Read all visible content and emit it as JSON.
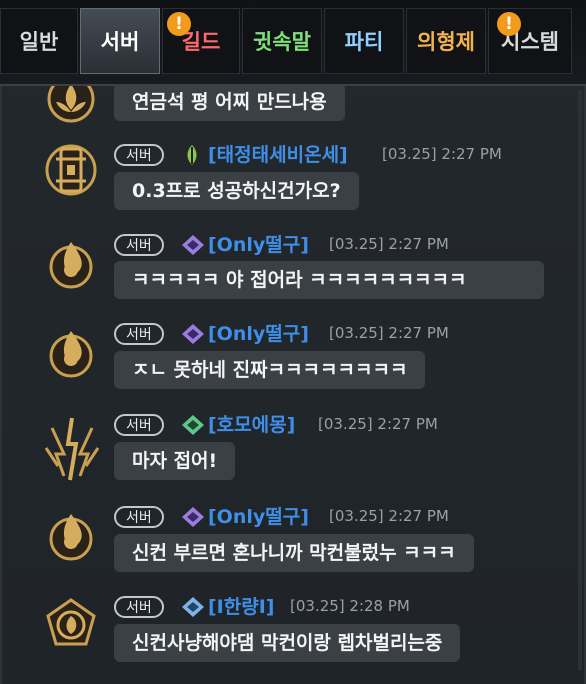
{
  "tabs": [
    {
      "label": "일반",
      "color": "#d8dadc",
      "active": false,
      "badge": false
    },
    {
      "label": "서버",
      "color": "#ffffff",
      "active": true,
      "badge": false
    },
    {
      "label": "길드",
      "color": "#ff6a6a",
      "active": false,
      "badge": true
    },
    {
      "label": "귓속말",
      "color": "#7fe07a",
      "active": false,
      "badge": false
    },
    {
      "label": "파티",
      "color": "#8fd0ff",
      "active": false,
      "badge": false
    },
    {
      "label": "의형제",
      "color": "#f1b34a",
      "active": false,
      "badge": false
    },
    {
      "label": "시스템",
      "color": "#d8dadc",
      "active": false,
      "badge": true
    }
  ],
  "badge_symbol": "!",
  "colors": {
    "accent": "#3f8fe8",
    "bubble": "#3b4045",
    "badge": "#f29a1a"
  },
  "messages": [
    {
      "avatar": "lotus-emblem-icon",
      "class_icon": null,
      "channel": null,
      "user": null,
      "time": null,
      "text": "연금석 평 어찌 만드나용"
    },
    {
      "avatar": "gate-emblem-icon",
      "class_icon": "leaf-class-icon",
      "channel": "서버",
      "user": "[태정태세비온세]",
      "time": "[03.25] 2:27 PM",
      "text": "0.3프로 성공하신건가오?"
    },
    {
      "avatar": "flame-emblem-icon",
      "class_icon": "purple-crest-icon",
      "channel": "서버",
      "user": "[Only떨구]",
      "time": "[03.25] 2:27 PM",
      "text": "ㅋㅋㅋㅋㅋ 야 접어라 ㅋㅋㅋㅋㅋㅋㅋㅋㅋ"
    },
    {
      "avatar": "flame-emblem-icon",
      "class_icon": "purple-crest-icon",
      "channel": "서버",
      "user": "[Only떨구]",
      "time": "[03.25] 2:27 PM",
      "text": "ㅈㄴ 못하네 진짜ㅋㅋㅋㅋㅋㅋㅋㅋ"
    },
    {
      "avatar": "lightning-emblem-icon",
      "class_icon": "green-crest-icon",
      "channel": "서버",
      "user": "[호모에몽]",
      "time": "[03.25] 2:27 PM",
      "text": "마자 접어!"
    },
    {
      "avatar": "flame-emblem-icon",
      "class_icon": "purple-crest-icon",
      "channel": "서버",
      "user": "[Only떨구]",
      "time": "[03.25] 2:27 PM",
      "text": "신컨 부르면 혼나니까 막컨불렀누 ㅋㅋㅋ"
    },
    {
      "avatar": "rose-emblem-icon",
      "class_icon": "blue-crest-icon",
      "channel": "서버",
      "user": "[I한량I]",
      "time": "[03.25] 2:28 PM",
      "text": "신컨사냥해야댐 막컨이랑 렙차벌리는중"
    }
  ]
}
